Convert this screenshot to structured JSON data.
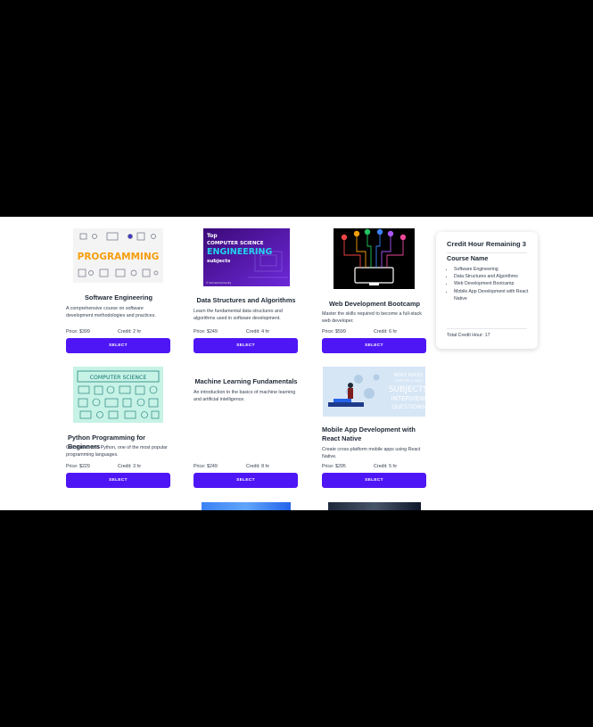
{
  "courses": [
    {
      "title": "Software Engineering",
      "description": "A comprehensive course on software development methodologies and practices.",
      "price": "Price: $399",
      "credit": "Credit: 2 hr",
      "button": "SELECT",
      "image_text": "PROGRAMMING"
    },
    {
      "title": "Data Structures and Algorithms",
      "description": "Learn the fundamental data structures and algorithms used in software development.",
      "price": "Price: $249",
      "credit": "Credit: 4 hr",
      "button": "SELECT",
      "image_text": {
        "l1": "Top",
        "l2": "COMPUTER SCIENCE",
        "l3": "ENGINEERING",
        "l4": "subjects",
        "l5": "© ScholarCommunity"
      }
    },
    {
      "title": "Web Development Bootcamp",
      "description": "Master the skills required to become a full-stack web developer.",
      "price": "Price: $599",
      "credit": "Credit: 6 hr",
      "button": "SELECT"
    },
    {
      "title": "Python Programming for Beginners",
      "description": "Get started with Python, one of the most popular programming languages.",
      "price": "Price: $229",
      "credit": "Credit: 3 hr",
      "button": "SELECT",
      "image_text": "COMPUTER SCIENCE"
    },
    {
      "title": "Machine Learning Fundamentals",
      "description": "An introduction to the basics of machine learning and artificial intelligence.",
      "price": "Price: $249",
      "credit": "Credit: 8 hr",
      "button": "SELECT"
    },
    {
      "title": "Mobile App Development with React Native",
      "description": "Create cross-platform mobile apps using React Native.",
      "price": "Price: $295",
      "credit": "Credit: 5 hr",
      "button": "SELECT",
      "image_text": {
        "l1": "MOST ASKED",
        "l2": "COMPUTER SCIENCE",
        "l3": "SUBJECTS",
        "l4": "INTERVIEW",
        "l5": "QUESTIONS"
      }
    }
  ],
  "cart": {
    "heading": "Credit Hour Remaining 3",
    "subheading": "Course Name",
    "items": [
      "Software Engineering",
      "Data Structures and Algorithms",
      "Web Development Bootcamp",
      "Mobile App Development with React Native"
    ],
    "total": "Total Credit Hour: 17"
  },
  "colors": {
    "accent": "#4f16f5"
  }
}
